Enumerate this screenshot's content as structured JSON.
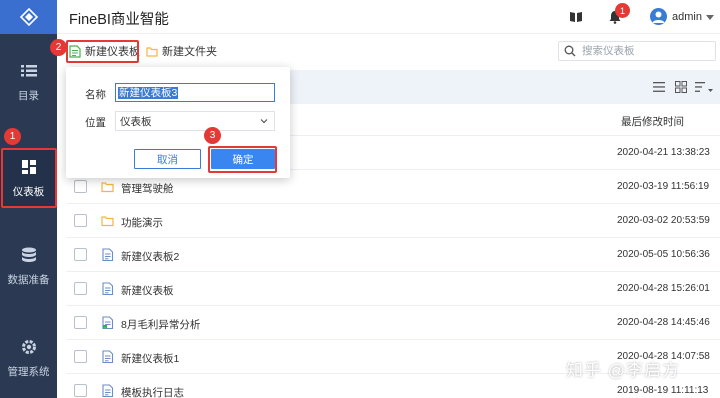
{
  "header": {
    "app_title": "FineBI商业智能",
    "notification_count": "1",
    "user_name": "admin"
  },
  "sidebar": {
    "items": [
      {
        "label": "目录",
        "icon": "list-icon"
      },
      {
        "label": "仪表板",
        "icon": "dashboard-icon"
      },
      {
        "label": "数据准备",
        "icon": "database-icon"
      },
      {
        "label": "管理系统",
        "icon": "gear-icon"
      }
    ]
  },
  "toolbar": {
    "new_dashboard": "新建仪表板",
    "new_folder": "新建文件夹",
    "search_placeholder": "搜索仪表板"
  },
  "annotations": {
    "step1": "1",
    "step2": "2",
    "step3": "3"
  },
  "table": {
    "column_modified": "最后修改时间",
    "rows": [
      {
        "name": "",
        "type": "hidden",
        "date": "2020-04-21 13:38:23"
      },
      {
        "name": "管理驾驶舱",
        "type": "folder",
        "date": "2020-03-19 11:56:19"
      },
      {
        "name": "功能演示",
        "type": "folder",
        "date": "2020-03-02 20:53:59"
      },
      {
        "name": "新建仪表板2",
        "type": "doc",
        "date": "2020-05-05 10:56:36"
      },
      {
        "name": "新建仪表板",
        "type": "doc",
        "date": "2020-04-28 15:26:01"
      },
      {
        "name": "8月毛利异常分析",
        "type": "doc-green",
        "date": "2020-04-28 14:45:46"
      },
      {
        "name": "新建仪表板1",
        "type": "doc",
        "date": "2020-04-28 14:07:58"
      },
      {
        "name": "模板执行日志",
        "type": "doc",
        "date": "2019-08-19 11:11:13"
      }
    ]
  },
  "dialog": {
    "name_label": "名称",
    "name_value": "新建仪表板3",
    "location_label": "位置",
    "location_value": "仪表板",
    "cancel_label": "取消",
    "ok_label": "确定"
  },
  "watermark": "知乎 @李启方",
  "colors": {
    "sidebar": "#2b3a52",
    "accent": "#3a86f0",
    "highlight": "#e53935",
    "folder": "#f5b544"
  }
}
